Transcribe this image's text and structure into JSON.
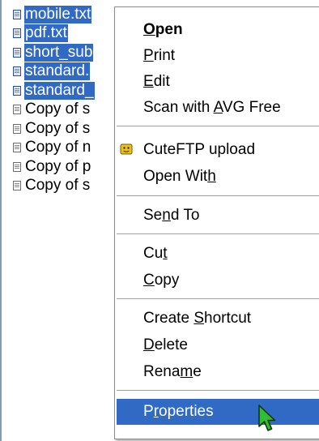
{
  "files": [
    {
      "name": "mobile.txt",
      "selected": true
    },
    {
      "name": "pdf.txt",
      "selected": true
    },
    {
      "name": "short_sub",
      "selected": true
    },
    {
      "name": "standard.",
      "selected": true
    },
    {
      "name": "standard_",
      "selected": true
    },
    {
      "name": "Copy of s",
      "selected": false
    },
    {
      "name": "Copy of s",
      "selected": false
    },
    {
      "name": "Copy of n",
      "selected": false
    },
    {
      "name": "Copy of p",
      "selected": false
    },
    {
      "name": "Copy of s",
      "selected": false
    }
  ],
  "menu": {
    "open": {
      "pre": "",
      "u": "O",
      "post": "pen"
    },
    "print": {
      "pre": "",
      "u": "P",
      "post": "rint"
    },
    "edit": {
      "pre": "",
      "u": "E",
      "post": "dit"
    },
    "scan": {
      "pre": "Scan with ",
      "u": "A",
      "post": "VG Free"
    },
    "cuteftp": {
      "pre": "CuteFTP upload",
      "u": "",
      "post": ""
    },
    "open_with": {
      "pre": "Open Wit",
      "u": "h",
      "post": ""
    },
    "send_to": {
      "pre": "Se",
      "u": "n",
      "post": "d To"
    },
    "cut": {
      "pre": "Cu",
      "u": "t",
      "post": ""
    },
    "copy": {
      "pre": "",
      "u": "C",
      "post": "opy"
    },
    "create_shortcut": {
      "pre": "Create ",
      "u": "S",
      "post": "hortcut"
    },
    "delete": {
      "pre": "",
      "u": "D",
      "post": "elete"
    },
    "rename": {
      "pre": "Rena",
      "u": "m",
      "post": "e"
    },
    "properties": {
      "pre": "P",
      "u": "r",
      "post": "operties"
    }
  },
  "colors": {
    "selection": "#316ac5",
    "pane_border": "#7f9db9",
    "cursor_fill": "#2fbf2f"
  },
  "icons": {
    "file": "text-file-icon",
    "ftp": "cuteftp-icon",
    "pointer": "mouse-pointer-icon"
  }
}
